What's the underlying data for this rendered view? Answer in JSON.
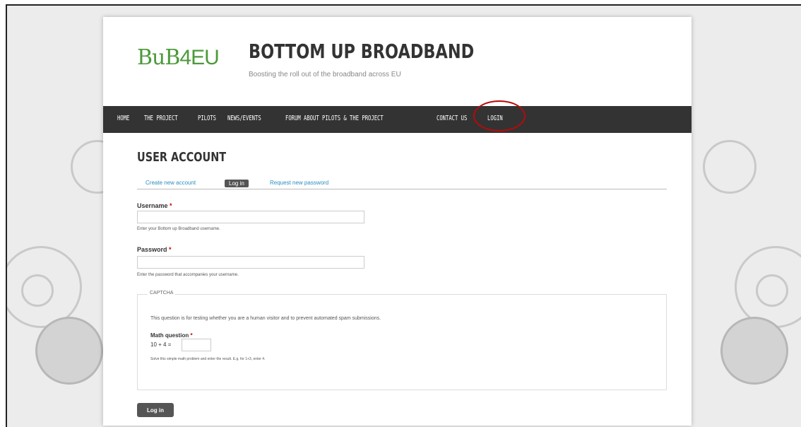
{
  "brand": {
    "logo_bold": "BuB",
    "logo_thin": "4EU",
    "site_name": "BOTTOM UP BROADBAND",
    "slogan": "Boosting the roll out of the broadband across EU"
  },
  "nav": {
    "items": [
      "HOME",
      "THE PROJECT",
      "PILOTS",
      "NEWS/EVENTS",
      "FORUM ABOUT PILOTS & THE PROJECT",
      "CONTACT US",
      "LOGIN"
    ]
  },
  "page": {
    "title": "USER ACCOUNT",
    "tabs": [
      "Create new account",
      "Log in",
      "Request new password"
    ]
  },
  "form": {
    "username_label": "Username",
    "username_value": "",
    "username_desc": "Enter your Bottom up Broadband username.",
    "password_label": "Password",
    "password_value": "",
    "password_desc": "Enter the password that accompanies your username.",
    "required_mark": "*",
    "captcha": {
      "legend": "CAPTCHA",
      "description": "This question is for testing whether you are a human visitor and to prevent automated spam submissions.",
      "math_label": "Math question",
      "math_question": "10 + 4 =",
      "math_value": "",
      "math_desc": "Solve this simple math problem and enter the result. E.g. for 1+3, enter 4."
    },
    "submit_label": "Log in"
  },
  "colors": {
    "brand_green": "#4c9a3a",
    "nav_bg": "#333333",
    "highlight_circle": "#b80a0a",
    "link_blue": "#2a8fbd"
  }
}
